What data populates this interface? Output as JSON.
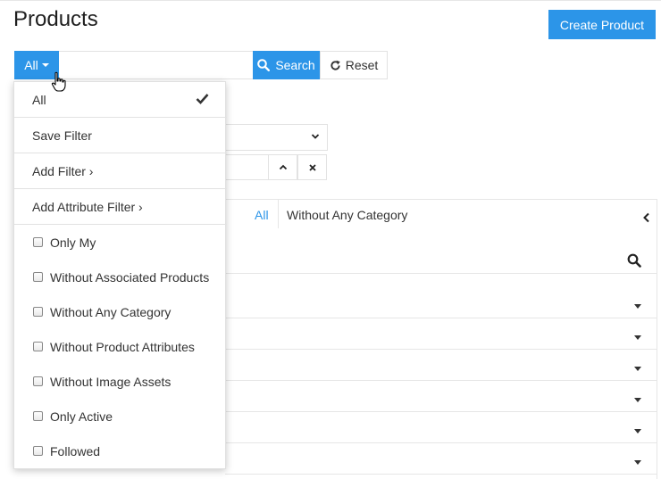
{
  "header": {
    "title": "Products",
    "create_label": "Create Product"
  },
  "toolbar": {
    "filter_label": "All",
    "search_placeholder": "",
    "search_label": "Search",
    "reset_label": "Reset"
  },
  "tabs": {
    "all": "All",
    "without_category": "Without Any Category"
  },
  "dropdown": {
    "all_label": "All",
    "save_filter": "Save Filter",
    "add_filter": "Add Filter ›",
    "add_attribute_filter": "Add Attribute Filter ›",
    "checkboxes": [
      "Only My",
      "Without Associated Products",
      "Without Any Category",
      "Without Product Attributes",
      "Without Image Assets",
      "Only Active",
      "Followed"
    ]
  },
  "colors": {
    "accent": "#2c95e8",
    "border": "#e2e2e2"
  },
  "icons": [
    "caret-down-icon",
    "search-icon",
    "refresh-icon",
    "chevron-down-icon",
    "chevron-up-icon",
    "close-icon",
    "chevron-left-icon",
    "check-icon",
    "pointer-cursor-icon"
  ]
}
